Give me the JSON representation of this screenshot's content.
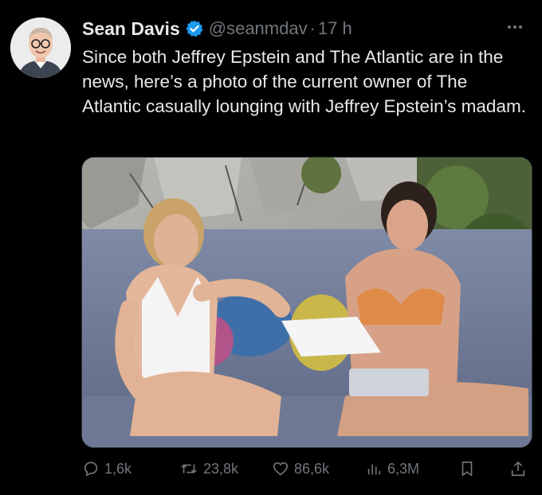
{
  "tweet": {
    "author": {
      "display_name": "Sean Davis",
      "handle": "@seanmdav",
      "verified_icon": "verified-badge-icon"
    },
    "separator": "·",
    "timestamp": "17 h",
    "text": "Since both Jeffrey Epstein and The Atlantic are in the news, here’s a photo of the current owner of The Atlantic casually lounging with Jeffrey Epstein’s madam.",
    "more_icon": "more-horizontal-icon",
    "media": {
      "icon": "attached-photo"
    },
    "stats": {
      "replies": "1,6k",
      "reposts": "23,8k",
      "likes": "86,6k",
      "views": "6,3M"
    },
    "icons": {
      "reply": "reply-icon",
      "repost": "repost-icon",
      "like": "like-icon",
      "views": "views-icon",
      "bookmark": "bookmark-icon",
      "share": "share-icon"
    },
    "colors": {
      "background": "#000000",
      "text": "#e7e9ea",
      "muted": "#71767b",
      "verified": "#1d9bf0"
    }
  }
}
